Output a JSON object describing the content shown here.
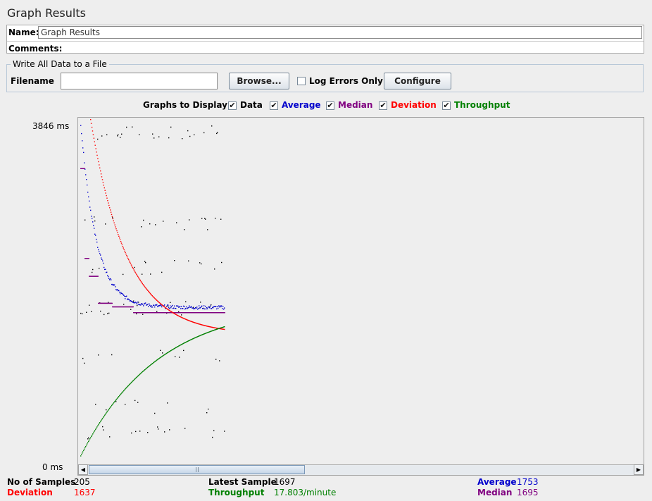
{
  "title": "Graph Results",
  "name_label": "Name:",
  "name_value": "Graph Results",
  "comments_label": "Comments:",
  "file_section": {
    "legend": "Write All Data to a File",
    "filename_label": "Filename",
    "filename_value": "",
    "browse_label": "Browse...",
    "log_errors_label": "Log Errors Only",
    "log_errors_checked": false,
    "configure_label": "Configure"
  },
  "graphs_to_display": {
    "label": "Graphs to Display",
    "options": [
      {
        "label": "Data",
        "checked": true,
        "color": "#000000"
      },
      {
        "label": "Average",
        "checked": true,
        "color": "#0000cc"
      },
      {
        "label": "Median",
        "checked": true,
        "color": "#800080"
      },
      {
        "label": "Deviation",
        "checked": true,
        "color": "#ff0000"
      },
      {
        "label": "Throughput",
        "checked": true,
        "color": "#008000"
      }
    ]
  },
  "y_axis": {
    "max_label": "3846 ms",
    "min_label": "0 ms"
  },
  "stats": {
    "samples_label": "No of Samples",
    "samples_value": "205",
    "latest_label": "Latest Sample",
    "latest_value": "1697",
    "average_label": "Average",
    "average_value": "1753",
    "deviation_label": "Deviation",
    "deviation_value": "1637",
    "throughput_label": "Throughput",
    "throughput_value": "17.803/minute",
    "median_label": "Median",
    "median_value": "1695"
  },
  "chart_data": {
    "type": "scatter",
    "ylim": [
      0,
      3846
    ],
    "num_samples": 205,
    "series": [
      {
        "name": "Average",
        "color": "#0000cc",
        "final_value": 1753
      },
      {
        "name": "Median",
        "color": "#800080",
        "final_value": 1695
      },
      {
        "name": "Deviation",
        "color": "#ff0000",
        "final_value": 1637
      },
      {
        "name": "Throughput",
        "color": "#008000",
        "final_value": "17.803/minute"
      }
    ],
    "data_clusters_ms": [
      3700,
      2700,
      2200,
      1750,
      1200,
      650,
      350
    ]
  }
}
